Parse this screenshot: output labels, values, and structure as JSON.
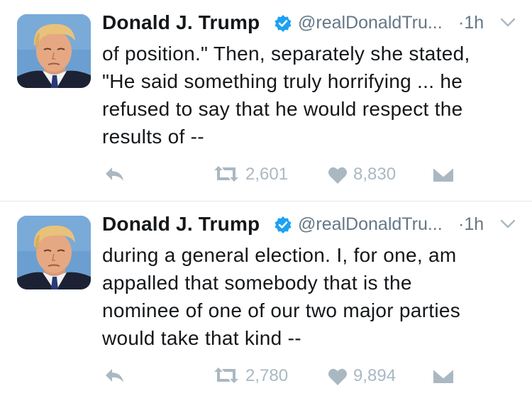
{
  "tweets": [
    {
      "author_name": "Donald J. Trump",
      "handle": "@realDonaldTru...",
      "time": "·1h",
      "text_lines": [
        "of position.\" Then, separately she stated,",
        "\"He said something truly horrifying ... he",
        "refused to say that he would respect the",
        "results of --"
      ],
      "retweets": "2,601",
      "likes": "8,830"
    },
    {
      "author_name": "Donald J. Trump",
      "handle": "@realDonaldTru...",
      "time": "·1h",
      "text_lines": [
        "during a general election. I, for one, am",
        "appalled that somebody that is the",
        "nominee of one of our two major parties",
        "would take that kind --"
      ],
      "retweets": "2,780",
      "likes": "9,894"
    }
  ],
  "icons": {
    "verified": "verified-badge-icon",
    "caret": "chevron-down-icon",
    "reply": "reply-icon",
    "retweet": "retweet-icon",
    "like": "heart-icon",
    "dm": "direct-message-icon"
  },
  "colors": {
    "verified_blue": "#1da1f2",
    "muted_gray": "#657786",
    "action_gray": "#aab8c2",
    "text": "#14171a"
  }
}
